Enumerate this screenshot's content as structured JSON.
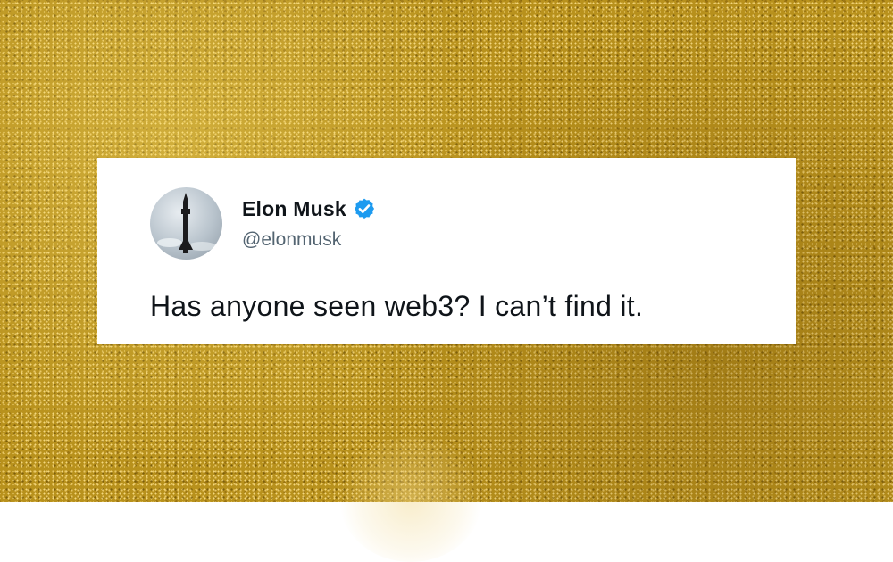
{
  "tweet": {
    "display_name": "Elon Musk",
    "handle": "@elonmusk",
    "text": "Has anyone seen web3? I can’t find it.",
    "verified": true,
    "avatar_icon": "rocket-silhouette-avatar",
    "verified_icon": "verified-badge-icon"
  },
  "colors": {
    "background_gold": "#b8911c",
    "card_background": "#ffffff",
    "name_color": "#0f1419",
    "handle_color": "#536471",
    "verified_blue": "#1d9bf0"
  }
}
